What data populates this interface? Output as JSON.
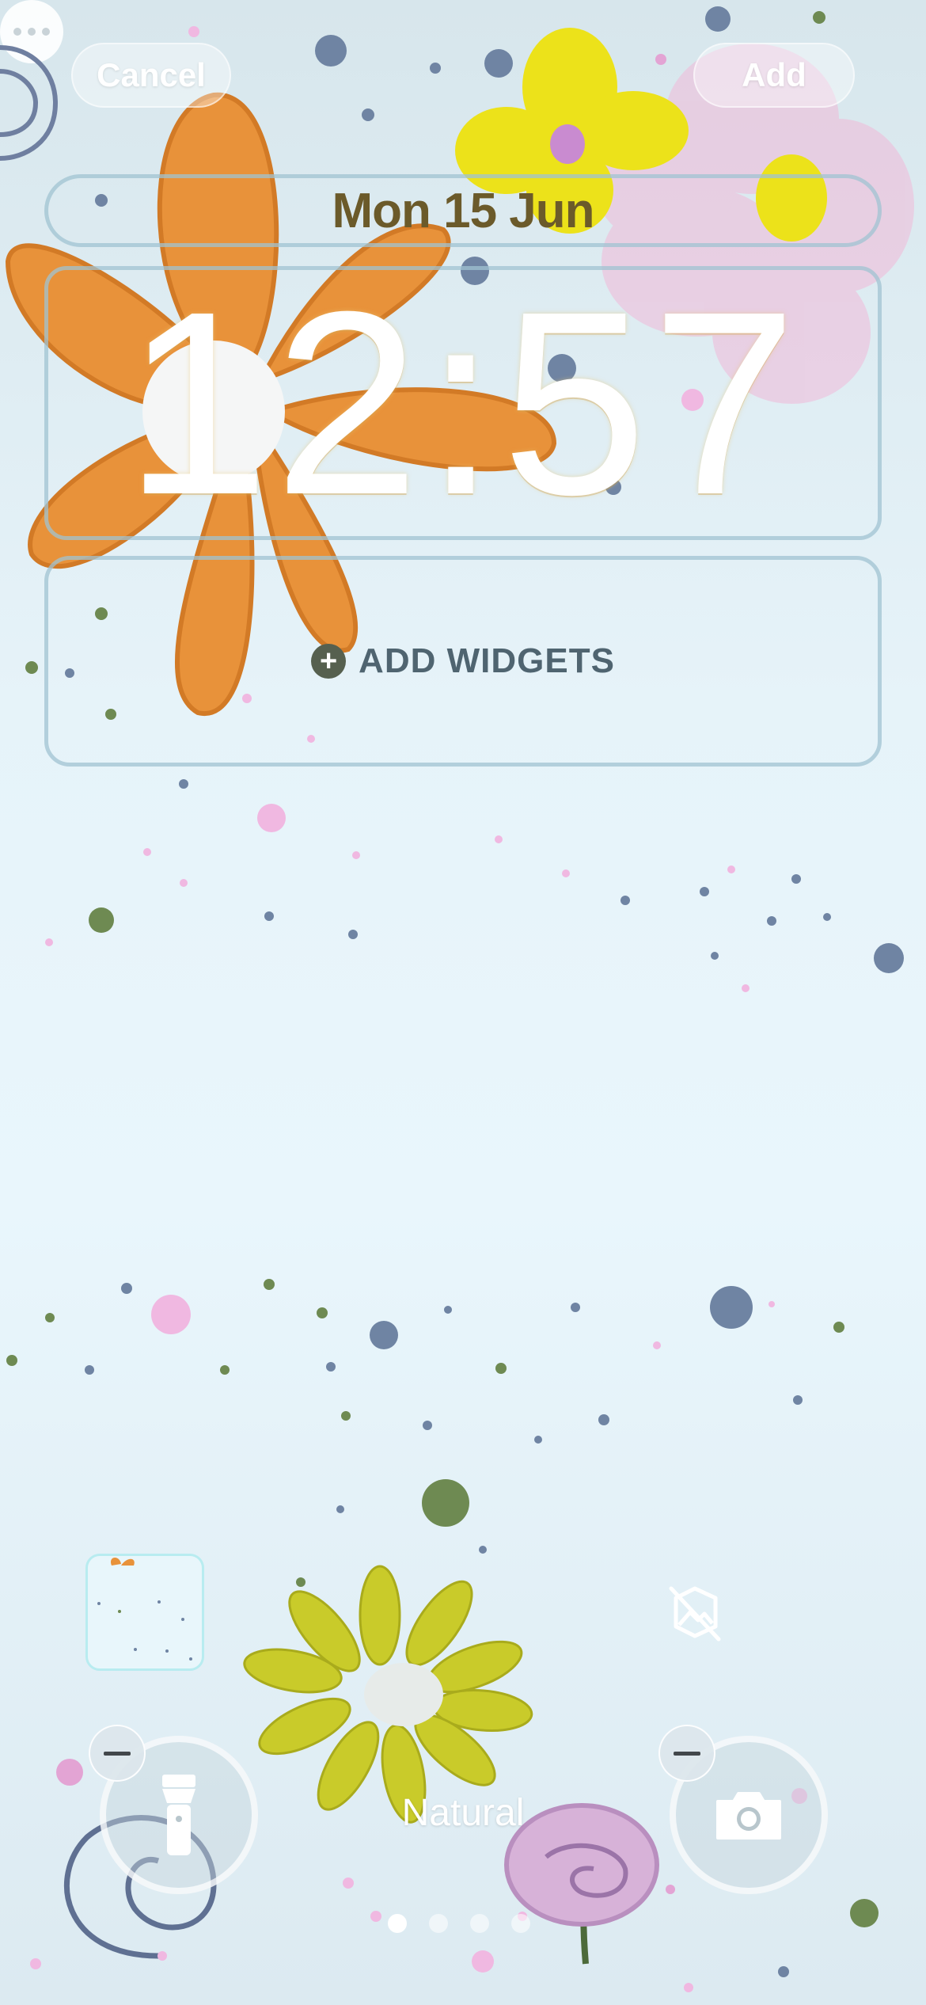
{
  "top_bar": {
    "cancel_label": "Cancel",
    "add_label": "Add"
  },
  "lock_screen": {
    "date": "Mon 15 Jun",
    "time": "12:57",
    "add_widgets_label": "ADD WIDGETS",
    "style_name": "Natural"
  },
  "icons": {
    "add_widgets": "plus-circle-icon",
    "photo_shuffle": "photo-slash-icon",
    "more": "ellipsis-icon",
    "flashlight": "flashlight-icon",
    "camera": "camera-icon",
    "remove": "minus-icon"
  },
  "pager": {
    "count": 4,
    "active_index": 0
  },
  "colors": {
    "accent_orange": "#e8923a",
    "flower_yellow": "#ece21a",
    "flower_pink": "#f0c6e2",
    "dot_blue": "#6f84a3",
    "dot_green": "#6e8a52",
    "frame_outline": "#a0c3d2"
  }
}
